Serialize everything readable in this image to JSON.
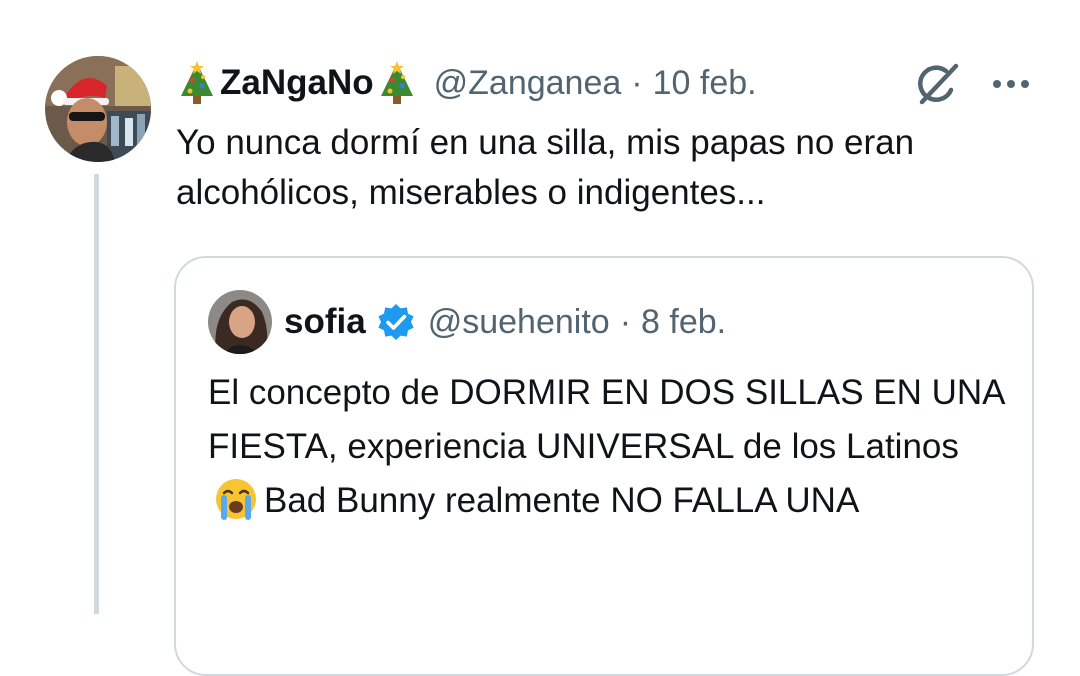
{
  "tweet": {
    "author_name": "ZaNgaNo",
    "name_prefix_emoji": "🎄",
    "name_suffix_emoji": "🎄",
    "handle": "@Zanganea",
    "separator": "·",
    "date": "10 feb.",
    "text": "Yo nunca dormí en una silla, mis papas no eran alcohólicos, miserables o indigentes..."
  },
  "quoted_tweet": {
    "author_name": "sofia",
    "handle": "@suehenito",
    "separator": "·",
    "date": "8 feb.",
    "text_before_emoji": "El concepto de DORMIR EN DOS SILLAS EN UNA FIESTA, experiencia UNIVERSAL de los Latinos",
    "emoji": "😭",
    "text_after_emoji": "Bad Bunny realmente NO FALLA UNA"
  },
  "icons": {
    "grok": "grok-icon",
    "more": "more-options-icon",
    "verified": "verified-badge-icon",
    "tree": "christmas-tree-emoji"
  },
  "colors": {
    "text": "#0f1419",
    "secondary_text": "#536471",
    "border": "#cfd9de",
    "verified": "#1d9bf0",
    "background": "#ffffff"
  }
}
